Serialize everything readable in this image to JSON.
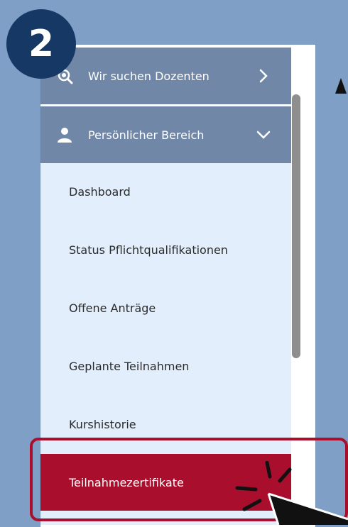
{
  "step_badge": "2",
  "menu": {
    "search_item": {
      "label": "Wir suchen Dozenten",
      "icon": "search-icon",
      "chevron": "chevron-right-icon"
    },
    "personal_item": {
      "label": "Persönlicher Bereich",
      "icon": "user-icon",
      "chevron": "chevron-down-icon"
    },
    "sub_items": [
      {
        "label": "Dashboard"
      },
      {
        "label": "Status Pflichtqualifikationen"
      },
      {
        "label": "Offene Anträge"
      },
      {
        "label": "Geplante Teilnahmen"
      },
      {
        "label": "Kurshistorie"
      },
      {
        "label": "Teilnahmezertifikate",
        "active": true
      }
    ]
  },
  "colors": {
    "background": "#7f9fc7",
    "menu_row": "#7187a8",
    "submenu": "#e3eefc",
    "active": "#a90f2d",
    "badge": "#163865"
  }
}
